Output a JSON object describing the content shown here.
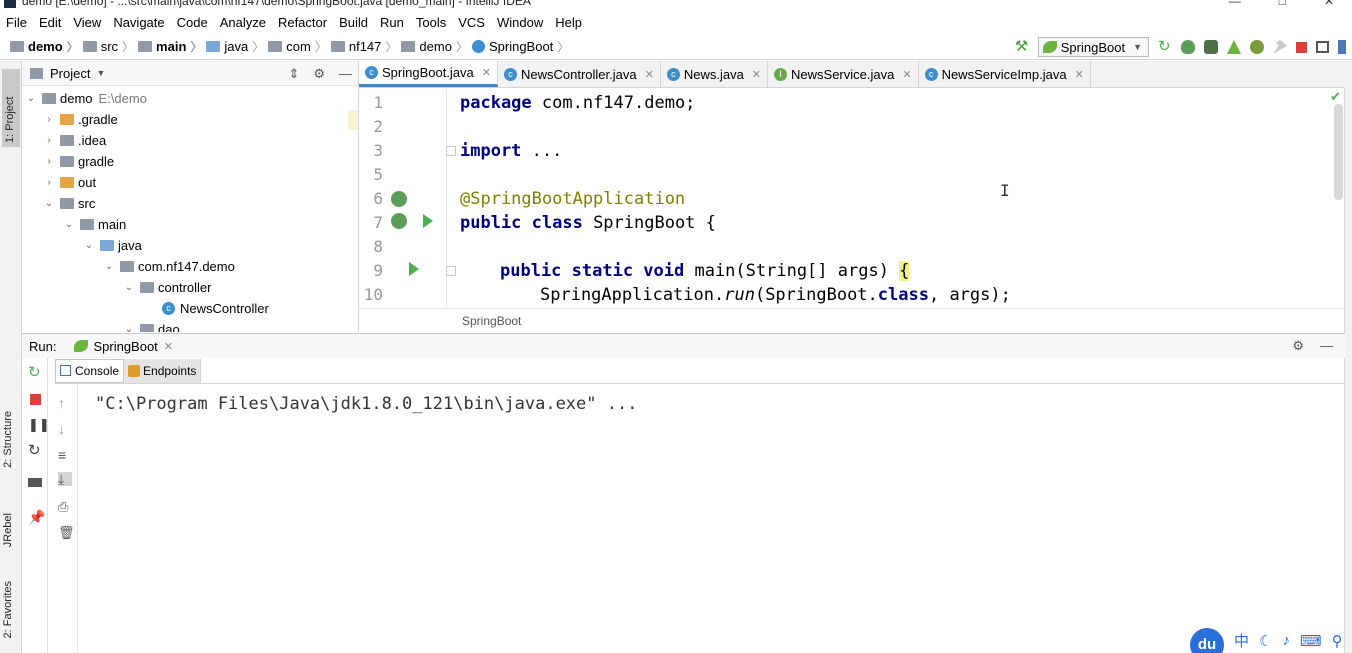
{
  "window": {
    "title": "demo [E:\\demo] - ...\\src\\main\\java\\com\\nf147\\demo\\SpringBoot.java [demo_main] - IntelliJ IDEA"
  },
  "menu": [
    "File",
    "Edit",
    "View",
    "Navigate",
    "Code",
    "Analyze",
    "Refactor",
    "Build",
    "Run",
    "Tools",
    "VCS",
    "Window",
    "Help"
  ],
  "nav": {
    "crumbs": [
      "demo",
      "src",
      "main",
      "java",
      "com",
      "nf147",
      "demo",
      "SpringBoot"
    ],
    "run_config": "SpringBoot"
  },
  "left_tabs": {
    "project": "1: Project",
    "structure": "2: Structure",
    "jrebel": "JRebel",
    "favorites": "2: Favorites"
  },
  "project": {
    "title": "Project",
    "tree": [
      {
        "label": "demo",
        "path": "E:\\demo"
      },
      {
        "label": ".gradle"
      },
      {
        "label": ".idea"
      },
      {
        "label": "gradle"
      },
      {
        "label": "out"
      },
      {
        "label": "src"
      },
      {
        "label": "main"
      },
      {
        "label": "java"
      },
      {
        "label": "com.nf147.demo"
      },
      {
        "label": "controller"
      },
      {
        "label": "NewsController"
      },
      {
        "label": "dao"
      }
    ]
  },
  "editor": {
    "tabs": [
      "SpringBoot.java",
      "NewsController.java",
      "News.java",
      "NewsService.java",
      "NewsServiceImp.java"
    ],
    "line_numbers": [
      "1",
      "2",
      "3",
      "5",
      "6",
      "7",
      "8",
      "9",
      "10"
    ],
    "code": {
      "l1_kw": "package",
      "l1_rest": " com.nf147.demo;",
      "l3_kw": "import",
      "l3_rest": " ...",
      "l6": "@SpringBootApplication",
      "l7_kw": "public class",
      "l7_rest": " SpringBoot {",
      "l9_kw": "public static void",
      "l9_rest": " main(String[] args) ",
      "l9_brace": "{",
      "l10_a": "SpringApplication.",
      "l10_b": "run",
      "l10_c": "(SpringBoot.",
      "l10_d": "class",
      "l10_e": ", args);"
    },
    "breadcrumb": "SpringBoot"
  },
  "run": {
    "label": "Run:",
    "config": "SpringBoot",
    "tabs": [
      "Console",
      "Endpoints"
    ],
    "console_line": "\"C:\\Program Files\\Java\\jdk1.8.0_121\\bin\\java.exe\" ..."
  },
  "tray": {
    "logo": "du",
    "ime": "中"
  },
  "colors": {
    "keyword": "#000080",
    "annotation": "#808000",
    "accent": "#4083c9",
    "run_green": "#4caf50",
    "spring_green": "#6db33f"
  }
}
